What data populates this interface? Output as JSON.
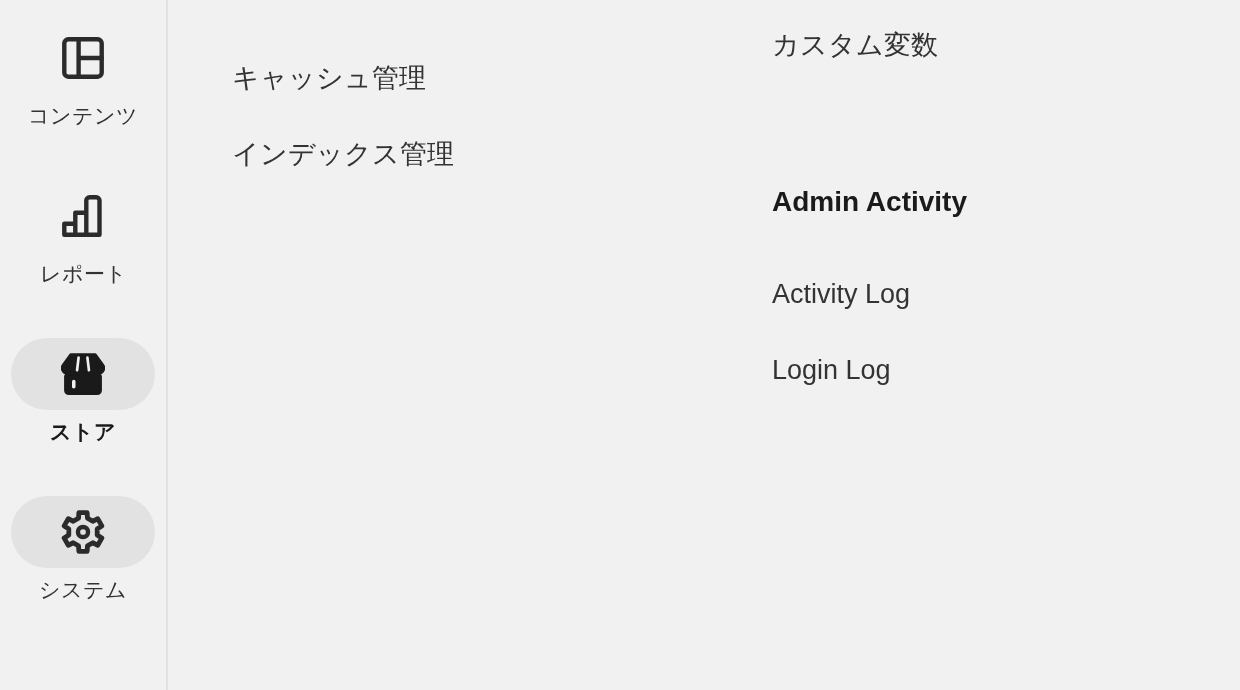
{
  "sidebar": {
    "items": [
      {
        "label": "コンテンツ",
        "selected": false,
        "hovered": false
      },
      {
        "label": "レポート",
        "selected": false,
        "hovered": false
      },
      {
        "label": "ストア",
        "selected": true,
        "hovered": false
      },
      {
        "label": "システム",
        "selected": false,
        "hovered": true
      }
    ]
  },
  "menu": {
    "columns": [
      {
        "groups": [
          {
            "links": [
              "キャッシュ管理",
              "インデックス管理"
            ]
          }
        ]
      },
      {
        "groups": [
          {
            "links": [
              "カスタム変数"
            ]
          },
          {
            "heading": "Admin Activity",
            "links": [
              "Activity Log",
              "Login Log"
            ]
          }
        ]
      }
    ]
  }
}
